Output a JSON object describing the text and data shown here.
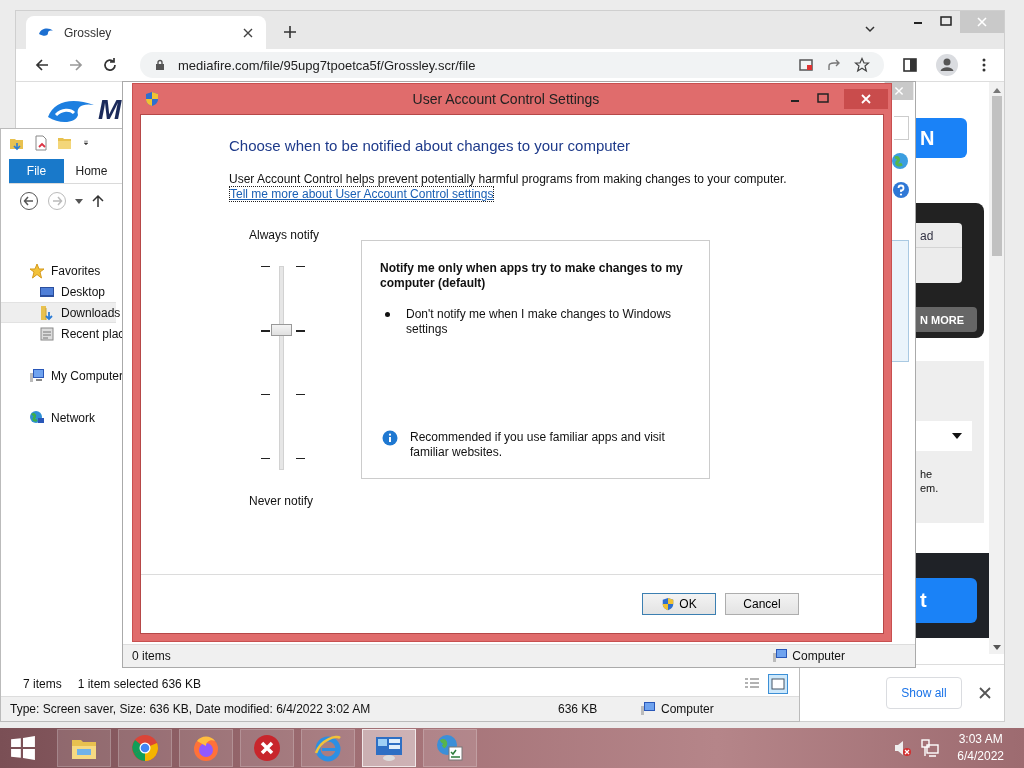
{
  "browser": {
    "tab_title": "Grossley",
    "url": "mediafire.com/file/95upg7tpoetca5f/Grossley.scr/file",
    "logo_text": "M",
    "page_fragments": {
      "top_button": "N",
      "card_text": "ad",
      "card_button": "N MORE",
      "panel_lines": [
        "he",
        "em."
      ],
      "bottom_button": "t"
    },
    "download_bar": {
      "show_all": "Show all"
    }
  },
  "explorer": {
    "ribbon_tabs": [
      {
        "label": "File",
        "selected": true
      },
      {
        "label": "Home",
        "selected": false
      }
    ],
    "nav": [
      {
        "label": "Favorites",
        "kind": "star",
        "selected": false,
        "children": [
          {
            "label": "Desktop",
            "kind": "desktop",
            "selected": false
          },
          {
            "label": "Downloads",
            "kind": "downloads",
            "selected": true
          },
          {
            "label": "Recent plac",
            "kind": "recent",
            "selected": false
          }
        ]
      },
      {
        "label": "My Computer",
        "kind": "computer",
        "selected": false
      },
      {
        "label": "Network",
        "kind": "network",
        "selected": false
      }
    ],
    "status": {
      "count": "7 items",
      "selection": "1 item selected  636 KB"
    },
    "details": {
      "info": "Type: Screen saver, Size: 636 KB, Date modified: 6/4/2022 3:02 AM",
      "size": "636 KB",
      "location": "Computer"
    }
  },
  "back_window": {
    "status": "0 items",
    "location": "Computer"
  },
  "dialog": {
    "title": "User Account Control Settings",
    "heading": "Choose when to be notified about changes to your computer",
    "description": "User Account Control helps prevent potentially harmful programs from making changes to your computer.",
    "link": "Tell me more about User Account Control settings",
    "slider": {
      "top_label": "Always notify",
      "bottom_label": "Never notify",
      "level": 0.667
    },
    "info_box": {
      "title": "Notify me only when apps try to make changes to my computer (default)",
      "bullets": [
        "Don't notify me when I make changes to Windows settings"
      ],
      "note": "Recommended if you use familiar apps and visit familiar websites."
    },
    "buttons": [
      {
        "label": "OK",
        "shield": true
      },
      {
        "label": "Cancel",
        "shield": false
      }
    ]
  },
  "taskbar": {
    "apps": [
      {
        "kind": "explorer",
        "selected": false
      },
      {
        "kind": "chrome",
        "selected": false
      },
      {
        "kind": "firefox",
        "selected": false
      },
      {
        "kind": "error",
        "selected": false
      },
      {
        "kind": "ie",
        "selected": false
      },
      {
        "kind": "control-panel",
        "selected": true
      },
      {
        "kind": "network-tasks",
        "selected": false
      }
    ],
    "time": "3:03 AM",
    "date": "6/4/2022"
  }
}
